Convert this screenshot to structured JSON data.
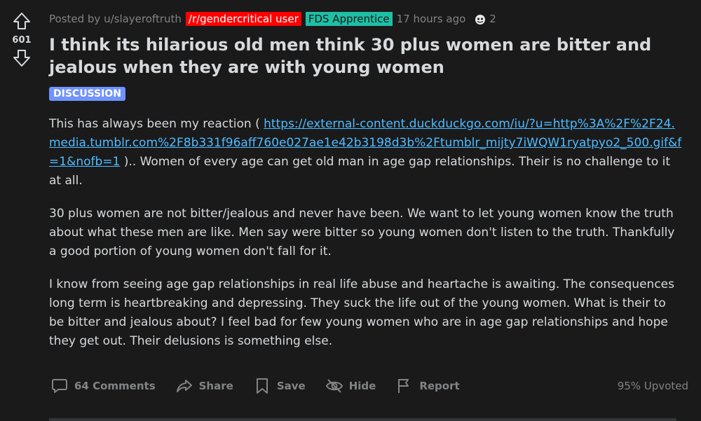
{
  "post": {
    "meta": {
      "posted_by": "Posted by u/slayeroftruth",
      "subreddit_flair": "/r/gendercritical user",
      "user_flair": "FDS Apprentice",
      "time": "17 hours ago",
      "award_count": "2"
    },
    "votes": "601",
    "title": "I think its hilarious old men think 30 plus women are bitter and jealous when they are with young women",
    "flair": "DISCUSSION",
    "body": {
      "p1_before": "This has always been my reaction ( ",
      "p1_link": "https://external-content.duckduckgo.com/iu/?u=http%3A%2F%2F24.media.tumblr.com%2F8b331f96aff760e027ae1e42b3198d3b%2Ftumblr_mijty7iWQW1ryatpyo2_500.gif&f=1&nofb=1",
      "p1_after": " ).. Women of every age can get old man in age gap relationships. Their is no challenge to it at all.",
      "p2": "30 plus women are not bitter/jealous and never have been. We want to let young women know the truth about what these men are like. Men say were bitter so young women don't listen to the truth. Thankfully a good portion of young women don't fall for it.",
      "p3": "I know from seeing age gap relationships in real life abuse and heartache is awaiting. The consequences long term is heartbreaking and depressing. They suck the life out of the young women. What is their to be bitter and jealous about? I feel bad for few young women who are in age gap relationships and hope they get out. Their delusions is something else."
    },
    "actions": {
      "comments": "64 Comments",
      "share": "Share",
      "save": "Save",
      "hide": "Hide",
      "report": "Report",
      "upvoted": "95% Upvoted"
    }
  },
  "icons": [
    "upvote-icon",
    "downvote-icon",
    "award-icon",
    "comment-icon",
    "share-icon",
    "save-icon",
    "hide-icon",
    "report-icon"
  ],
  "colors": {
    "background": "#1a1a1b",
    "text": "#d7dadc",
    "muted": "#818384",
    "link": "#4fbcff",
    "sub_flair": "#ff0000",
    "user_flair": "#1ebfa5",
    "post_flair": "#7193ff"
  }
}
